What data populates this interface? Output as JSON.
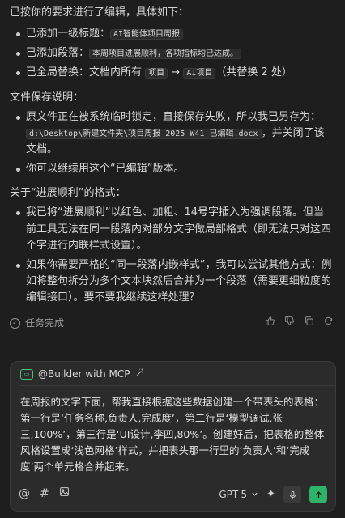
{
  "message": {
    "intro": "已按你的要求进行了编辑，具体如下：",
    "edits": [
      {
        "prefix": "已添加一级标题：",
        "code": "AI智能体项目周报",
        "suffix": ""
      },
      {
        "prefix": "已添加段落：",
        "code": "本周项目进展顺利，各项指标均已达成。",
        "suffix": ""
      },
      {
        "prefix": "已全局替换：文档内所有 ",
        "code": "项目",
        "middle": " → ",
        "code2": "AI项目",
        "suffix": "（共替换 2 处）"
      }
    ],
    "save_title": "文件保存说明：",
    "save_items": [
      {
        "text_a": "原文件正在被系统临时锁定，直接保存失败，所以我已另存为：",
        "code": "d:\\Desktop\\新建文件夹\\项目周报_2025_W41_已编辑.docx",
        "text_b": "，并关闭了该文档。"
      },
      {
        "text_a": "你可以继续用这个“已编辑”版本。"
      }
    ],
    "format_title": "关于“进展顺利”的格式：",
    "format_items": [
      "我已将“进展顺利”以红色、加粗、14号字插入为强调段落。但当前工具无法在同一段落内对部分文字做局部格式（即无法只对这四个字进行内联样式设置）。",
      "如果你需要严格的“同一段落内嵌样式”，我可以尝试其他方式：例如将整句拆分为多个文本块然后合并为一个段落（需要更细粒度的编辑接口）。要不要我继续这样处理？"
    ]
  },
  "status": {
    "label": "任务完成",
    "icons": [
      "thumbs-up-icon",
      "thumbs-down-icon",
      "copy-icon",
      "refresh-icon"
    ]
  },
  "composer": {
    "agent_label": "@Builder with MCP",
    "input_text": "在周报的文字下面，帮我直接根据这些数据创建一个带表头的表格：第一行是‘任务名称,负责人,完成度’，第二行是‘模型调试,张三,100%’，第三行是‘UI设计,李四,80%’。创建好后，把表格的整体风格设置成‘浅色网格’样式，并把表头那一行里的‘负责人’和‘完成度’两个单元格合并起来。",
    "model": "GPT-5",
    "accent_color": "#2fb36a"
  }
}
